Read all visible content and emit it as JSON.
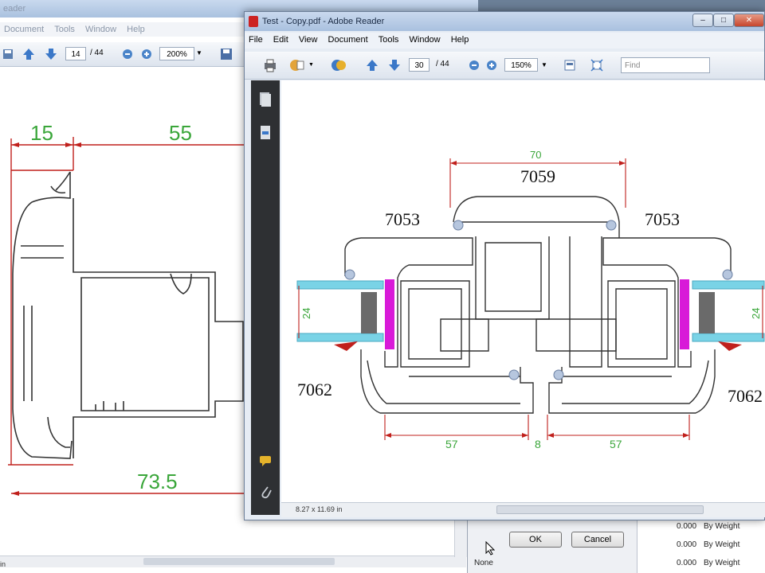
{
  "back_window": {
    "title": "eader",
    "menu": [
      "Document",
      "Tools",
      "Window",
      "Help"
    ],
    "page_current": "14",
    "page_total": "/ 44",
    "zoom": "200%",
    "dims": {
      "d15": "15",
      "d55": "55",
      "d73_5": "73.5"
    }
  },
  "front_window": {
    "title": "Test - Copy.pdf - Adobe Reader",
    "menu": [
      "File",
      "Edit",
      "View",
      "Document",
      "Tools",
      "Window",
      "Help"
    ],
    "page_current": "30",
    "page_total": "/ 44",
    "zoom": "150%",
    "find_placeholder": "Find",
    "page_size": "8.27 x 11.69 in",
    "drawing": {
      "dim_top": "70",
      "dim_left_glass": "24",
      "dim_right_glass": "24",
      "dim_bottom_left": "57",
      "dim_bottom_mid": "8",
      "dim_bottom_right": "57",
      "label_top": "7059",
      "label_left_top": "7053",
      "label_right_top": "7053",
      "label_left_bottom": "7062",
      "label_right_bottom": "7062"
    }
  },
  "dialog": {
    "ok": "OK",
    "cancel": "Cancel",
    "rows": [
      {
        "col1": "",
        "value": "0.000",
        "method": "By Weight"
      },
      {
        "col1": "",
        "value": "0.000",
        "method": "By Weight"
      },
      {
        "col1": "None",
        "value": "0.000",
        "method": "By Weight"
      }
    ]
  },
  "colors": {
    "dim_red": "#c0201c",
    "dim_green": "#3aa63a",
    "glass": "#79d3e6",
    "gasket": "#d81ad8"
  }
}
